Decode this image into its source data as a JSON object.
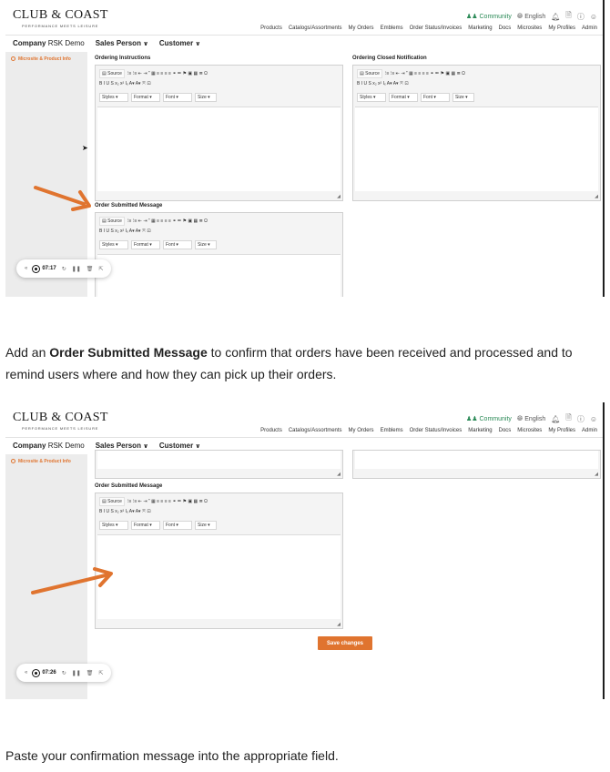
{
  "app": {
    "logo": "CLUB & COAST",
    "tagline": "PERFORMANCE MEETS LEISURE",
    "utility": {
      "community": "Community",
      "language": "English",
      "icons": [
        "bell-icon",
        "document-icon",
        "help-icon",
        "user-icon"
      ]
    },
    "nav": [
      "Products",
      "Catalogs/Assortments",
      "My Orders",
      "Emblems",
      "Order Status/Invoices",
      "Marketing",
      "Docs",
      "Microsites",
      "My Profiles",
      "Admin"
    ],
    "context": {
      "company_label": "Company",
      "company_value": "RSK Demo",
      "sales_person": "Sales Person",
      "customer": "Customer"
    },
    "sidebar_item": "Microsite & Product Info"
  },
  "editor_toolbar": {
    "source": "Source",
    "row1_icons": "⁝≡ ⁝≡  ⇤ ⇥  ” ▦  ≡ ≡ ≡ ≡   ⚭ ⚮ ⚑   ▣ ▦ ≣ Ω",
    "row2": "B  I  U  S  x₂  x²  Iₓ    A▾  A▾   ⤧  ⊡",
    "styles": "Styles",
    "format": "Format",
    "font": "Font",
    "size": "Size"
  },
  "shot1": {
    "ordering_instructions": "Ordering Instructions",
    "ordering_closed": "Ordering Closed Notification",
    "order_submitted": "Order Submitted Message",
    "recorder_time": "07:17"
  },
  "shot2": {
    "order_submitted": "Order Submitted Message",
    "save_button": "Save changes",
    "recorder_time": "07:26"
  },
  "captions": {
    "step1_pre": "Add an ",
    "step1_bold": "Order Submitted Message",
    "step1_post": " to confirm that orders have been received and processed and to remind users where and how they can pick up their orders.",
    "step2": "Paste your confirmation message into the appropriate field."
  },
  "colors": {
    "accent_orange": "#e0742f",
    "community_green": "#2b8a57",
    "sidebar_gray": "#ececec"
  }
}
